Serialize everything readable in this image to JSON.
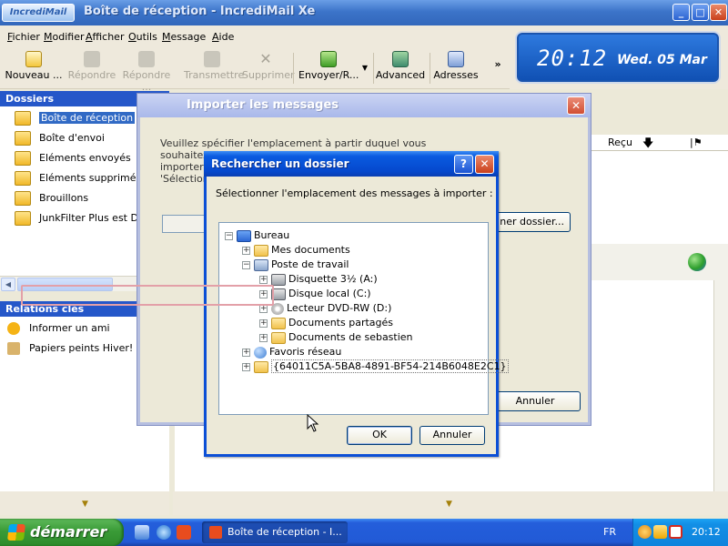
{
  "window": {
    "logo": "IncrediMail",
    "title": "Boîte de réception - IncrediMail Xe",
    "minimize": "_",
    "maximize": "□",
    "close": "✕"
  },
  "menu": [
    "Fichier",
    "Modifier",
    "Afficher",
    "Outils",
    "Message",
    "Aide"
  ],
  "toolbar": {
    "nouveau": "Nouveau ...",
    "repondre": "Répondre",
    "repondre_tous": "Répondre ...",
    "transmettre": "Transmettre",
    "supprimer": "Supprimer",
    "envoyer": "Envoyer/R...",
    "advanced": "Advanced",
    "adresses": "Adresses",
    "more": "»"
  },
  "clock": {
    "time": "20:12",
    "date": "Wed. 05 Mar"
  },
  "folders": {
    "header": "Dossiers",
    "items": [
      "Boîte de réception",
      "Boîte d'envoi",
      "Eléments envoyés",
      "Eléments supprimés",
      "Brouillons",
      "JunkFilter Plus est DÉS"
    ]
  },
  "keys": {
    "header": "Relations clés",
    "items": [
      "Informer un ami",
      "Papiers peints Hiver!"
    ]
  },
  "list": {
    "col_recu": "Reçu",
    "sort_icon": "🡇",
    "flag_icon": "|⚑"
  },
  "import_dialog": {
    "title": "Importer les messages",
    "close": "✕",
    "desc_line1": "Veuillez spécifier l'emplacement à partir duquel vous souhaitez",
    "desc_line2": "importer le",
    "desc_line3": "'Sélection",
    "browse_button": "ner dossier...",
    "cancel_button": "Annuler"
  },
  "browse_dialog": {
    "title": "Rechercher un dossier",
    "help": "?",
    "close": "✕",
    "label": "Sélectionner l'emplacement des messages à importer :",
    "ok": "OK",
    "cancel": "Annuler",
    "tree": [
      {
        "label": "Bureau",
        "expander": "−",
        "icon": "desktop-icon"
      },
      {
        "label": "Mes documents",
        "expander": "+",
        "icon": "folder-icon"
      },
      {
        "label": "Poste de travail",
        "expander": "−",
        "icon": "computer-icon"
      },
      {
        "label": "Disquette 3½ (A:)",
        "expander": "+",
        "icon": "floppy-icon"
      },
      {
        "label": "Disque local (C:)",
        "expander": "+",
        "icon": "harddisk-icon"
      },
      {
        "label": "Lecteur DVD-RW (D:)",
        "expander": "+",
        "icon": "dvd-icon"
      },
      {
        "label": "Documents partagés",
        "expander": "+",
        "icon": "folder-icon"
      },
      {
        "label": "Documents de sebastien",
        "expander": "+",
        "icon": "folder-icon"
      },
      {
        "label": "Favoris réseau",
        "expander": "+",
        "icon": "network-icon"
      },
      {
        "label": "{64011C5A-5BA8-4891-BF54-214B6048E2C1}",
        "expander": "+",
        "icon": "folder-icon"
      }
    ]
  },
  "taskbar": {
    "start": "démarrer",
    "task": "Boîte de réception - I...",
    "lang": "FR",
    "time": "20:12"
  }
}
